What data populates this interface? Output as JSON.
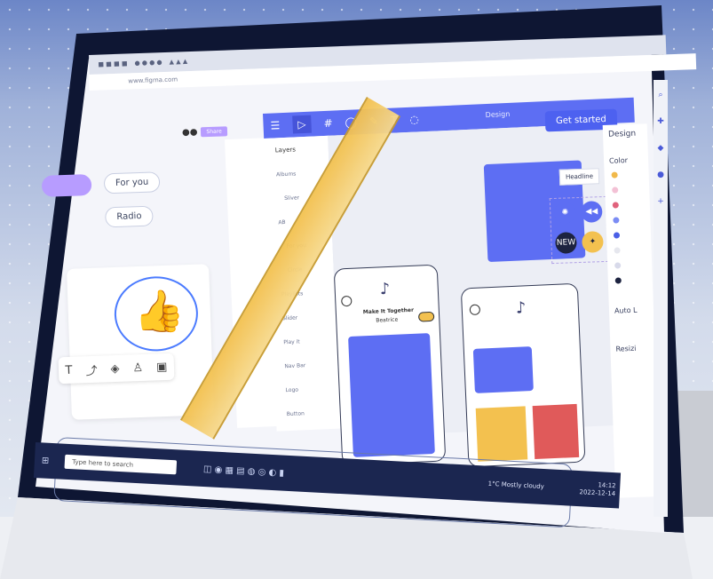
{
  "browser": {
    "url": "www.figma.com"
  },
  "canvas": {
    "nodes": [
      "For you",
      "Radio"
    ]
  },
  "toolbar": {
    "design_label": "Design",
    "share_label": "Share"
  },
  "layers": {
    "title": "Layers",
    "items": [
      "Albums",
      "Sliver",
      "AB",
      "For you",
      "Circle",
      "Playlists",
      "Slider",
      "Play it",
      "Nav Bar",
      "Logo",
      "Button"
    ]
  },
  "cta": {
    "label": "Get started"
  },
  "chips": {
    "headline": "Headline"
  },
  "right_panel": {
    "design_tab": "Design",
    "color_label": "Color",
    "auto_label": "Auto L",
    "resize_label": "Resizi",
    "swatches": [
      "#f1b94a",
      "#f3c1d5",
      "#e0627c",
      "#7b8cf4",
      "#4a5fe6",
      "#e6e7ee",
      "#d8daea",
      "#1d2340"
    ]
  },
  "phone1": {
    "title": "Make It Together",
    "subtitle": "Beatrice"
  },
  "taskbar": {
    "search_placeholder": "Type here to search",
    "weather": "1°C  Mostly cloudy",
    "time": "14:12",
    "date": "2022-12-14"
  }
}
